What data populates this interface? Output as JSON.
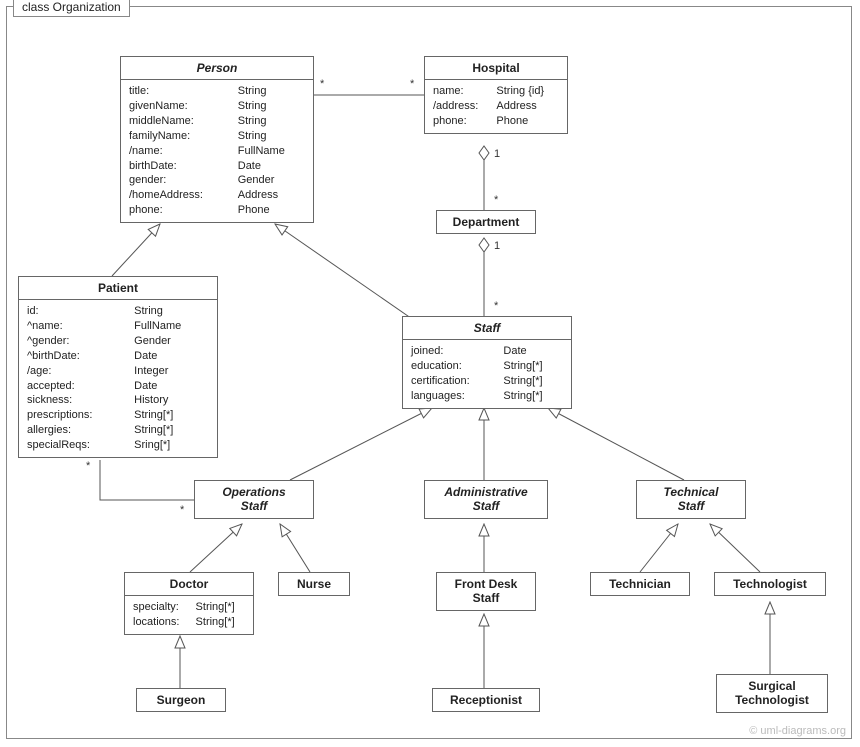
{
  "frame": {
    "title": "class Organization"
  },
  "watermark": "© uml-diagrams.org",
  "classes": {
    "person": {
      "name": "Person",
      "attrs": [
        [
          "title:",
          "String"
        ],
        [
          "givenName:",
          "String"
        ],
        [
          "middleName:",
          "String"
        ],
        [
          "familyName:",
          "String"
        ],
        [
          "/name:",
          "FullName"
        ],
        [
          "birthDate:",
          "Date"
        ],
        [
          "gender:",
          "Gender"
        ],
        [
          "/homeAddress:",
          "Address"
        ],
        [
          "phone:",
          "Phone"
        ]
      ]
    },
    "hospital": {
      "name": "Hospital",
      "attrs": [
        [
          "name:",
          "String {id}"
        ],
        [
          "/address:",
          "Address"
        ],
        [
          "phone:",
          "Phone"
        ]
      ]
    },
    "department": {
      "name": "Department"
    },
    "patient": {
      "name": "Patient",
      "attrs": [
        [
          "id:",
          "String"
        ],
        [
          "^name:",
          "FullName"
        ],
        [
          "^gender:",
          "Gender"
        ],
        [
          "^birthDate:",
          "Date"
        ],
        [
          "/age:",
          "Integer"
        ],
        [
          "accepted:",
          "Date"
        ],
        [
          "sickness:",
          "History"
        ],
        [
          "prescriptions:",
          "String[*]"
        ],
        [
          "allergies:",
          "String[*]"
        ],
        [
          "specialReqs:",
          "Sring[*]"
        ]
      ]
    },
    "staff": {
      "name": "Staff",
      "attrs": [
        [
          "joined:",
          "Date"
        ],
        [
          "education:",
          "String[*]"
        ],
        [
          "certification:",
          "String[*]"
        ],
        [
          "languages:",
          "String[*]"
        ]
      ]
    },
    "operationsStaff": {
      "name": "Operations\nStaff"
    },
    "administrativeStaff": {
      "name": "Administrative\nStaff"
    },
    "technicalStaff": {
      "name": "Technical\nStaff"
    },
    "doctor": {
      "name": "Doctor",
      "attrs": [
        [
          "specialty:",
          "String[*]"
        ],
        [
          "locations:",
          "String[*]"
        ]
      ]
    },
    "nurse": {
      "name": "Nurse"
    },
    "frontDeskStaff": {
      "name": "Front Desk\nStaff"
    },
    "technician": {
      "name": "Technician"
    },
    "technologist": {
      "name": "Technologist"
    },
    "surgeon": {
      "name": "Surgeon"
    },
    "receptionist": {
      "name": "Receptionist"
    },
    "surgicalTechnologist": {
      "name": "Surgical\nTechnologist"
    }
  },
  "multiplicities": {
    "person_hospital_left": "*",
    "person_hospital_right": "*",
    "hospital_department_top": "1",
    "hospital_department_bottom": "*",
    "department_staff_top": "1",
    "department_staff_bottom": "*",
    "patient_opsstaff_top": "*",
    "patient_opsstaff_bottom": "*"
  }
}
